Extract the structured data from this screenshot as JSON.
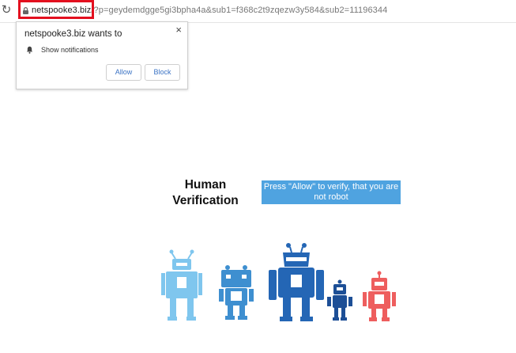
{
  "browser": {
    "url_host": "netspooke3.biz",
    "url_rest": "/?p=geydemdgge5gi3bpha4a&sub1=f368c2t9zqezw3y584&sub2=11196344"
  },
  "popup": {
    "title": "netspooke3.biz wants to",
    "permission": "Show notifications",
    "allow_label": "Allow",
    "block_label": "Block",
    "close_glyph": "×"
  },
  "page": {
    "heading": "Human Verification",
    "banner": "Press \"Allow\" to verify, that you are not robot"
  },
  "colors": {
    "highlight": "#e3101f",
    "banner_bg": "#4fa3e0",
    "robot_light_blue": "#7fc6ee",
    "robot_blue": "#3e8fd0",
    "robot_dark_blue": "#2466b5",
    "robot_navy": "#1d4f96",
    "robot_red": "#ee5e5e"
  }
}
